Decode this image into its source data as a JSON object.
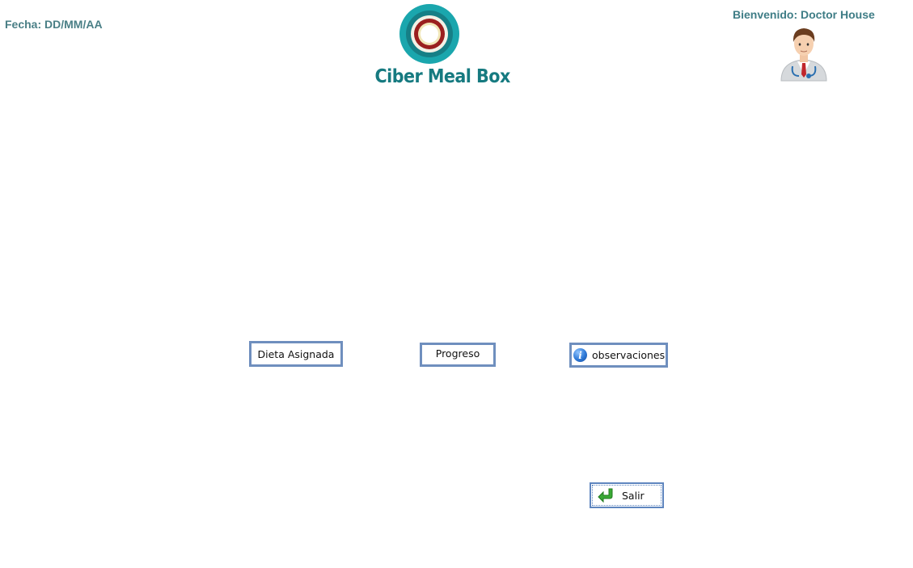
{
  "header": {
    "date_label": "Fecha: DD/MM/AA",
    "welcome_label": "Bienvenido: Doctor House",
    "brand_name": "Ciber Meal Box"
  },
  "actions": {
    "diet_label": "Dieta Asignada",
    "progress_label": "Progreso",
    "observations_label": "observaciones",
    "exit_label": "Salir"
  },
  "icons": {
    "logo": "ring-logo-icon",
    "avatar": "doctor-avatar-icon",
    "info": "info-icon",
    "exit": "green-return-arrow-icon"
  },
  "colors": {
    "header_text": "#3f7d86",
    "brand": "#167a80",
    "button_border": "#6f8fbe"
  }
}
